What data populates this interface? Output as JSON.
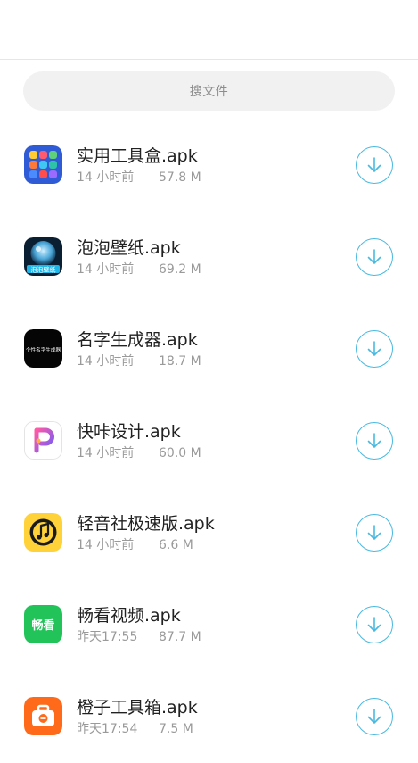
{
  "search": {
    "placeholder": "搜文件"
  },
  "files": [
    {
      "name": "实用工具盒.apk",
      "time": "14 小时前",
      "size": "57.8 M",
      "icon": "toolbox-app-icon",
      "icon_text": ""
    },
    {
      "name": "泡泡壁纸.apk",
      "time": "14 小时前",
      "size": "69.2 M",
      "icon": "bubble-wallpaper-app-icon",
      "icon_text": "泡泡壁纸"
    },
    {
      "name": "名字生成器.apk",
      "time": "14 小时前",
      "size": "18.7 M",
      "icon": "name-generator-app-icon",
      "icon_text": "个性名字生成器"
    },
    {
      "name": "快咔设计.apk",
      "time": "14 小时前",
      "size": "60.0 M",
      "icon": "kuaika-design-app-icon",
      "icon_text": ""
    },
    {
      "name": "轻音社极速版.apk",
      "time": "14 小时前",
      "size": "6.6 M",
      "icon": "music-note-app-icon",
      "icon_text": ""
    },
    {
      "name": "畅看视频.apk",
      "time": "昨天17:55",
      "size": "87.7 M",
      "icon": "changkan-video-app-icon",
      "icon_text": "畅看"
    },
    {
      "name": "橙子工具箱.apk",
      "time": "昨天17:54",
      "size": "7.5 M",
      "icon": "orange-toolbox-app-icon",
      "icon_text": ""
    }
  ],
  "colors": {
    "accent": "#49b9e0",
    "search_bg": "#f1f1f1",
    "meta_text": "#9a9a9a"
  }
}
